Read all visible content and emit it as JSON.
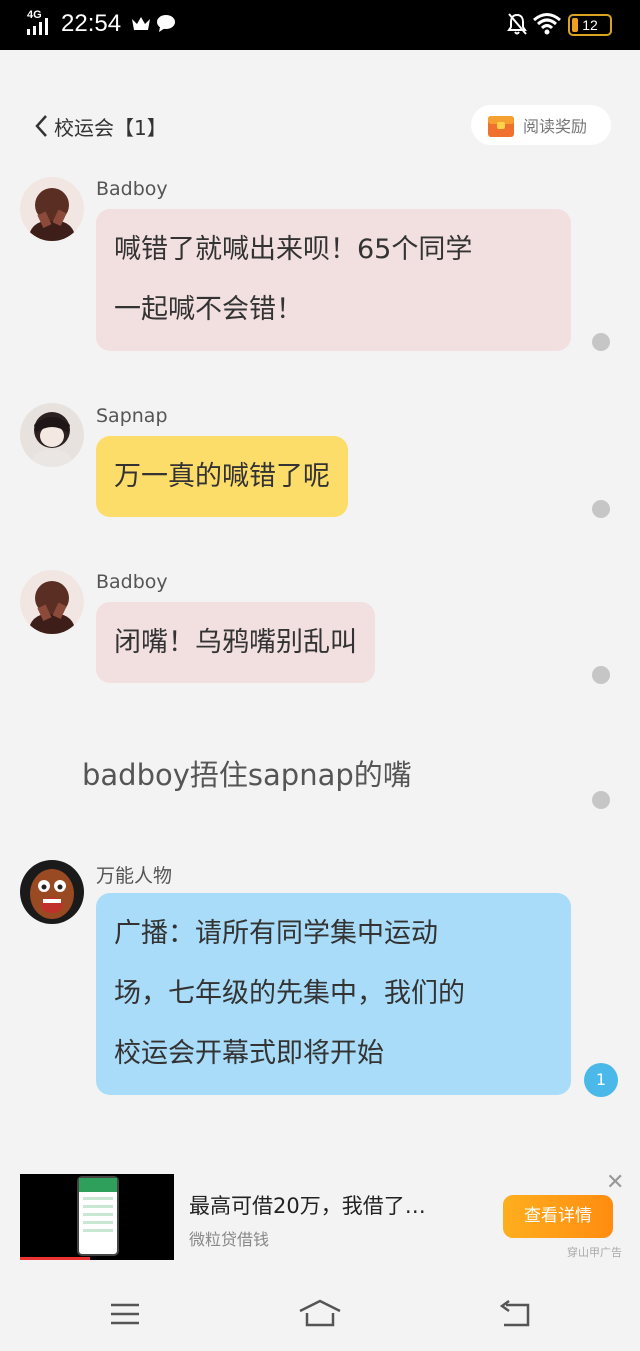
{
  "status_bar": {
    "network": "4G",
    "time": "22:54",
    "battery": "12",
    "icons": [
      "signal-icon",
      "crown-icon",
      "chat-bubble-icon",
      "bell-off-icon",
      "wifi-icon",
      "battery-icon"
    ]
  },
  "header": {
    "title": "校运会【1】",
    "reward_label": "阅读奖励",
    "icons": [
      "back-chevron-icon",
      "gift-box-icon"
    ]
  },
  "messages": [
    {
      "sender": "Badboy",
      "lines": [
        "喊错了就喊出来呗！65个同学",
        "一起喊不会错！"
      ],
      "color": "#f2dfe0"
    },
    {
      "sender": "Sapnap",
      "lines": [
        "万一真的喊错了呢"
      ],
      "color": "#fddd6a"
    },
    {
      "sender": "Badboy",
      "lines": [
        "闭嘴！乌鸦嘴别乱叫"
      ],
      "color": "#f2dfe0"
    },
    {
      "narration": "badboy捂住sapnap的嘴"
    },
    {
      "sender": "万能人物",
      "lines": [
        "广播：请所有同学集中运动",
        "场，七年级的先集中，我们的",
        "校运会开幕式即将开始"
      ],
      "color": "#a9dcf8",
      "badge": "1"
    }
  ],
  "ad": {
    "headline": "最高可借20万，我借了…",
    "source": "微粒贷借钱",
    "cta": "查看详情",
    "tag": "穿山甲广告",
    "close": "✕"
  },
  "nav_bar": {
    "icons": [
      "menu-icon",
      "home-icon",
      "back-icon"
    ]
  }
}
